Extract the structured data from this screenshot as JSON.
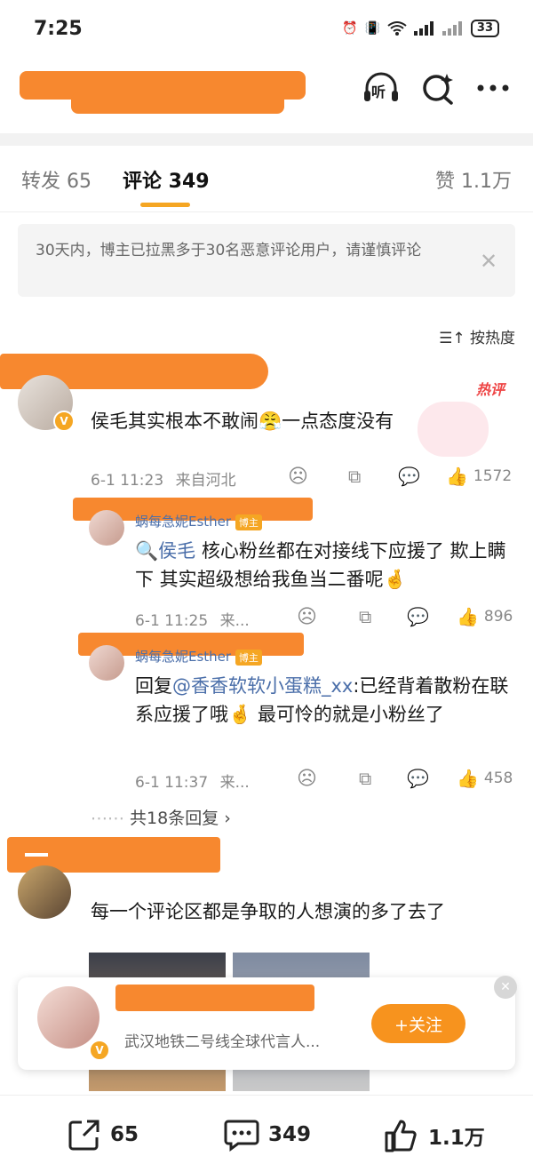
{
  "status_bar": {
    "time": "7:25",
    "battery": "33"
  },
  "header": {
    "listen_label": "听"
  },
  "tabs": [
    {
      "label": "转发 65"
    },
    {
      "label": "评论 349"
    },
    {
      "label": "赞 1.1万"
    }
  ],
  "notice": {
    "text": "30天内，博主已拉黑多于30名恶意评论用户，请谨慎评论"
  },
  "sort": {
    "label": "按热度"
  },
  "comments": [
    {
      "hot_label": "热评",
      "text": "侯毛其实根本不敢闹😤一点态度没有",
      "time": "6-1 11:23",
      "source": "来自河北",
      "likes": "1572",
      "replies": [
        {
          "username": "蜗每急妮Esther",
          "badge": "博主",
          "mention": "侯毛",
          "text": " 核心粉丝都在对接线下应援了 欺上瞒下 其实超级想给我鱼当二番呢🤞",
          "time": "6-1 11:25",
          "source": "来...",
          "likes": "896"
        },
        {
          "username": "蜗每急妮Esther",
          "badge": "博主",
          "prefix": "回复",
          "mention": "@香香软软小蛋糕_xx",
          "text": ":已经背着散粉在联系应援了哦🤞 最可怜的就是小粉丝了",
          "time": "6-1 11:37",
          "source": "来...",
          "likes": "458"
        }
      ],
      "more_replies": "共18条回复"
    },
    {
      "text": "每一个评论区都是争取的人想演的多了去了"
    }
  ],
  "follow_card": {
    "subtitle": "武汉地铁二号线全球代言人...",
    "button": "+关注"
  },
  "bottom_bar": {
    "repost": "65",
    "comment": "349",
    "like": "1.1万"
  },
  "colors": {
    "accent": "#f5a623",
    "redaction": "#f7882f",
    "link": "#4a6ea9",
    "hot": "#e44444"
  }
}
